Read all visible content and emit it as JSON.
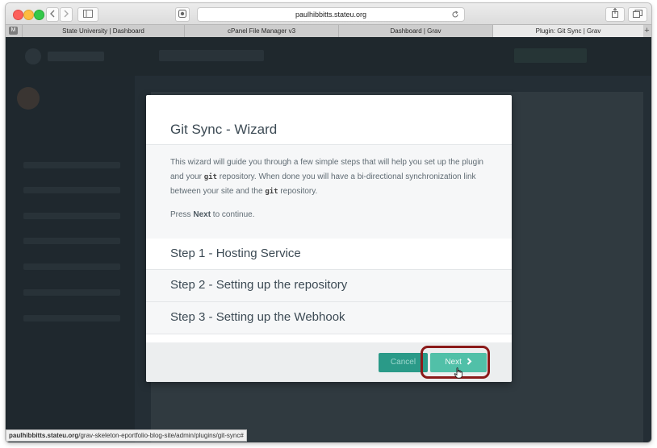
{
  "browser": {
    "url": "paulhibbitts.stateu.org",
    "tabs": [
      {
        "label": "State University | Dashboard"
      },
      {
        "label": "cPanel File Manager v3"
      },
      {
        "label": "Dashboard | Grav"
      },
      {
        "label": "Plugin: Git Sync | Grav"
      }
    ],
    "status_bar": {
      "host": "paulhibbitts.stateu.org",
      "path": "/grav-skeleton-eportfolio-blog-site/admin/plugins/git-sync#"
    }
  },
  "modal": {
    "title": "Git Sync - Wizard",
    "intro_part1": "This wizard will guide you through a few simple steps that will help you set up the plugin and your ",
    "intro_git1": "git",
    "intro_part2": " repository. When done you will have a bi-directional synchronization link between your site and the ",
    "intro_git2": "git",
    "intro_part3": " repository.",
    "continue_prefix": "Press ",
    "continue_bold": "Next",
    "continue_suffix": " to continue.",
    "steps": [
      {
        "label": "Step 1 - Hosting Service"
      },
      {
        "label": "Step 2 - Setting up the repository"
      },
      {
        "label": "Step 3 - Setting up the Webhook"
      }
    ],
    "cancel_label": "Cancel",
    "next_label": "Next",
    "next_icon": "chevron-right-icon"
  },
  "colors": {
    "accent": "#51c0a8",
    "accent_dark": "#2a9a88",
    "highlight": "#8b1a1a"
  }
}
